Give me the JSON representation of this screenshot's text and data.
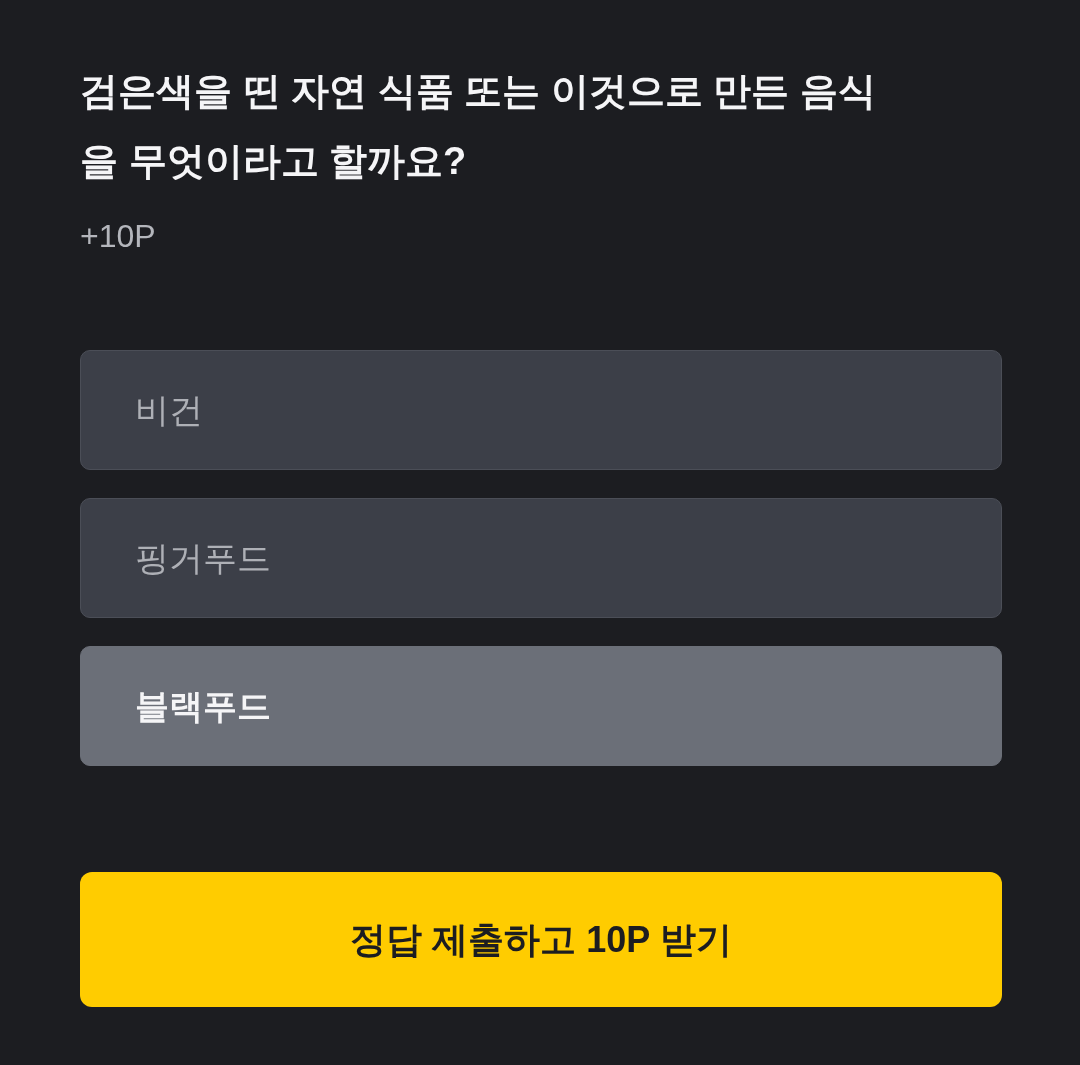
{
  "question": "검은색을 띤 자연 식품 또는 이것으로 만든 음식을 무엇이라고 할까요?",
  "points": "+10P",
  "options": [
    {
      "label": "비건",
      "selected": false
    },
    {
      "label": "핑거푸드",
      "selected": false
    },
    {
      "label": "블랙푸드",
      "selected": true
    }
  ],
  "submit_button": "정답 제출하고 10P 받기"
}
